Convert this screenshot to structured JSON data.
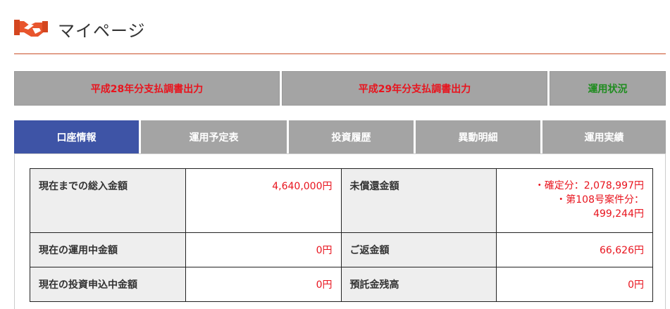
{
  "header": {
    "title": "マイページ",
    "logo_icon": "handshake-icon"
  },
  "reports": {
    "r1": "平成28年分支払調書出力",
    "r2": "平成29年分支払調書出力",
    "r3": "運用状況"
  },
  "tabs": {
    "t1": "口座情報",
    "t2": "運用予定表",
    "t3": "投資履歴",
    "t4": "異動明細",
    "t5": "運用実績"
  },
  "account": {
    "total_invested_label": "現在までの総入金額",
    "total_invested_value": "4,640,000円",
    "unredeemed_label": "未償還金額",
    "unredeemed_line1": "・確定分：2,078,997円",
    "unredeemed_line2": "・第108号案件分：",
    "unredeemed_line3": "499,244円",
    "operating_label": "現在の運用中金額",
    "operating_value": "0円",
    "repayment_label": "ご返金額",
    "repayment_value": "66,626円",
    "applying_label": "現在の投資申込中金額",
    "applying_value": "0円",
    "deposit_label": "預託金残高",
    "deposit_value": "0円"
  },
  "colors": {
    "accent": "#c9502a",
    "active_tab": "#3e54a6",
    "value_red": "#e8141e",
    "green": "#1e8c1e"
  }
}
